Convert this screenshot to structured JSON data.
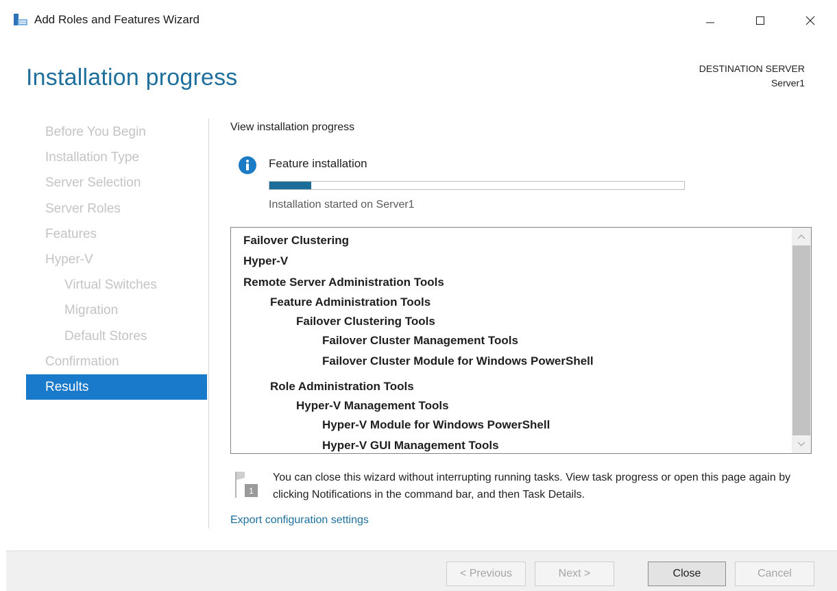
{
  "window": {
    "title": "Add Roles and Features Wizard",
    "icon": "server-manager-icon",
    "controls": {
      "minimize": "minimize-icon",
      "maximize": "maximize-icon",
      "close": "close-icon"
    }
  },
  "header": {
    "heading": "Installation progress",
    "destination_label": "DESTINATION SERVER",
    "destination_value": "Server1"
  },
  "nav": {
    "items": [
      {
        "label": "Before You Begin",
        "indent": 0,
        "active": false
      },
      {
        "label": "Installation Type",
        "indent": 0,
        "active": false
      },
      {
        "label": "Server Selection",
        "indent": 0,
        "active": false
      },
      {
        "label": "Server Roles",
        "indent": 0,
        "active": false
      },
      {
        "label": "Features",
        "indent": 0,
        "active": false
      },
      {
        "label": "Hyper-V",
        "indent": 0,
        "active": false
      },
      {
        "label": "Virtual Switches",
        "indent": 1,
        "active": false
      },
      {
        "label": "Migration",
        "indent": 1,
        "active": false
      },
      {
        "label": "Default Stores",
        "indent": 1,
        "active": false
      },
      {
        "label": "Confirmation",
        "indent": 0,
        "active": false
      },
      {
        "label": "Results",
        "indent": 0,
        "active": true
      }
    ]
  },
  "content": {
    "section_label": "View installation progress",
    "feature_label": "Feature installation",
    "progress_fraction": 0.1,
    "status_text": "Installation started on Server1",
    "results": [
      {
        "label": "Failover Clustering",
        "level": 0
      },
      {
        "label": "Hyper-V",
        "level": 0
      },
      {
        "label": "Remote Server Administration Tools",
        "level": 0
      },
      {
        "label": "Feature Administration Tools",
        "level": 1
      },
      {
        "label": "Failover Clustering Tools",
        "level": 2
      },
      {
        "label": "Failover Cluster Management Tools",
        "level": 3
      },
      {
        "label": "Failover Cluster Module for Windows PowerShell",
        "level": 3
      },
      {
        "label": "Role Administration Tools",
        "level": 1
      },
      {
        "label": "Hyper-V Management Tools",
        "level": 2
      },
      {
        "label": "Hyper-V Module for Windows PowerShell",
        "level": 3
      },
      {
        "label": "Hyper-V GUI Management Tools",
        "level": 3
      }
    ],
    "notice_text": "You can close this wizard without interrupting running tasks. View task progress or open this page again by clicking Notifications in the command bar, and then Task Details.",
    "notice_badge": "1",
    "export_link": "Export configuration settings"
  },
  "footer": {
    "previous": "< Previous",
    "next": "Next >",
    "close": "Close",
    "cancel": "Cancel"
  },
  "colors": {
    "accent": "#1e6f9c",
    "nav_active_bg": "#1979ca",
    "progress_fill": "#1a6e99",
    "info_icon": "#1b7bc4"
  }
}
